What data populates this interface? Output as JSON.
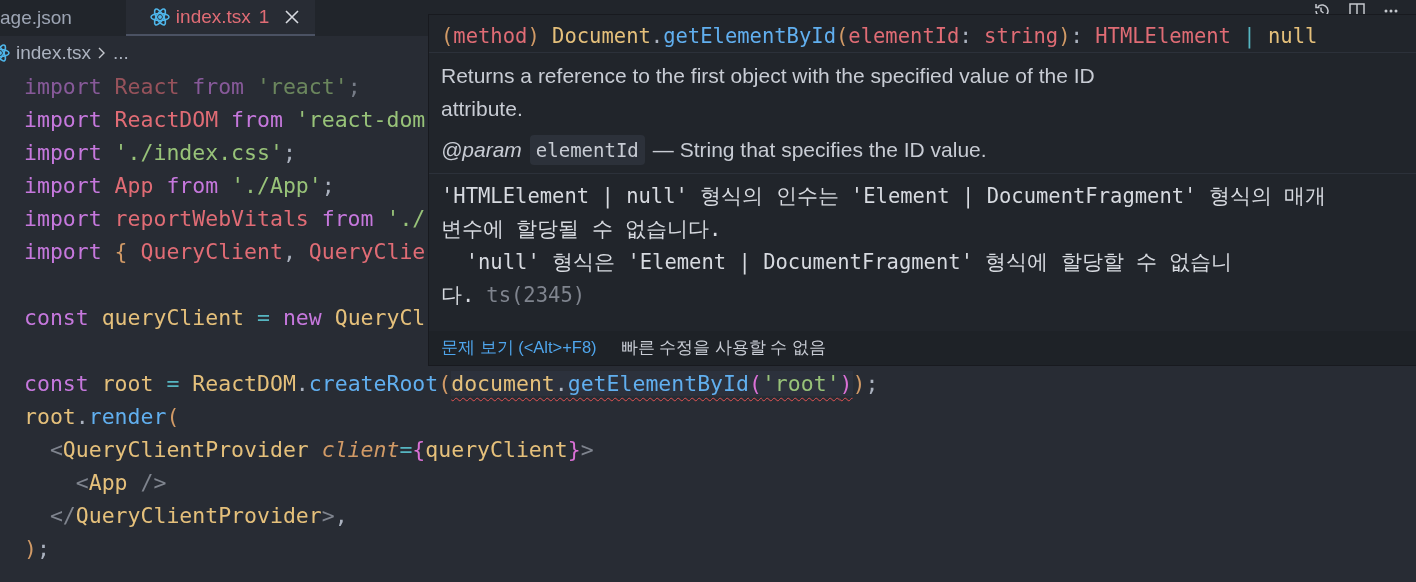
{
  "tabs": [
    {
      "label": "age.json",
      "selected": false
    },
    {
      "label": "index.tsx",
      "badge": "1",
      "selected": true
    }
  ],
  "breadcrumb": {
    "file": "index.tsx",
    "more": "..."
  },
  "code_lines": [
    {
      "kind": "code",
      "faded": true,
      "tokens": [
        {
          "kind": "keyword",
          "text": "import "
        },
        {
          "kind": "variable",
          "text": "React "
        },
        {
          "kind": "keyword",
          "text": "from "
        },
        {
          "kind": "string",
          "text": "'react'"
        },
        {
          "kind": "plain",
          "text": ";"
        }
      ]
    },
    {
      "kind": "code",
      "faded": false,
      "tokens": [
        {
          "kind": "keyword",
          "text": "import "
        },
        {
          "kind": "variable",
          "text": "ReactDOM "
        },
        {
          "kind": "keyword",
          "text": "from "
        },
        {
          "kind": "string",
          "text": "'react-dom"
        }
      ]
    },
    {
      "kind": "code",
      "faded": false,
      "tokens": [
        {
          "kind": "keyword",
          "text": "import "
        },
        {
          "kind": "string",
          "text": "'./index.css'"
        },
        {
          "kind": "plain",
          "text": ";"
        }
      ]
    },
    {
      "kind": "code",
      "faded": false,
      "tokens": [
        {
          "kind": "keyword",
          "text": "import "
        },
        {
          "kind": "variable",
          "text": "App "
        },
        {
          "kind": "keyword",
          "text": "from "
        },
        {
          "kind": "string",
          "text": "'./App'"
        },
        {
          "kind": "plain",
          "text": ";"
        }
      ]
    },
    {
      "kind": "code",
      "faded": false,
      "tokens": [
        {
          "kind": "keyword",
          "text": "import "
        },
        {
          "kind": "variable",
          "text": "reportWebVitals "
        },
        {
          "kind": "keyword",
          "text": "from "
        },
        {
          "kind": "string",
          "text": "'./"
        }
      ]
    },
    {
      "kind": "code",
      "faded": false,
      "tokens": [
        {
          "kind": "keyword",
          "text": "import "
        },
        {
          "kind": "bracket1",
          "text": "{ "
        },
        {
          "kind": "variable",
          "text": "QueryClient"
        },
        {
          "kind": "plain",
          "text": ", "
        },
        {
          "kind": "variable",
          "text": "QueryClie"
        }
      ]
    },
    {
      "kind": "blank"
    },
    {
      "kind": "code",
      "faded": false,
      "tokens": [
        {
          "kind": "keyword",
          "text": "const "
        },
        {
          "kind": "type",
          "text": "queryClient "
        },
        {
          "kind": "operator",
          "text": "= "
        },
        {
          "kind": "keyword",
          "text": "new "
        },
        {
          "kind": "type",
          "text": "QueryCl"
        }
      ]
    },
    {
      "kind": "blank"
    },
    {
      "kind": "code",
      "faded": false,
      "tokens": [
        {
          "kind": "keyword",
          "text": "const "
        },
        {
          "kind": "type",
          "text": "root "
        },
        {
          "kind": "operator",
          "text": "= "
        },
        {
          "kind": "type",
          "text": "ReactDOM"
        },
        {
          "kind": "plain",
          "text": "."
        },
        {
          "kind": "function",
          "text": "createRoot"
        },
        {
          "kind": "bracket1",
          "text": "("
        },
        {
          "kind": "error",
          "tokens": [
            {
              "kind": "type",
              "text": "document"
            },
            {
              "kind": "plain",
              "text": "."
            },
            {
              "kind": "function",
              "text": "getElementById"
            },
            {
              "kind": "bracket2",
              "text": "("
            },
            {
              "kind": "string",
              "text": "'root'"
            },
            {
              "kind": "bracket2",
              "text": ")"
            }
          ]
        },
        {
          "kind": "bracket1",
          "text": ")"
        },
        {
          "kind": "plain",
          "text": ";"
        }
      ]
    },
    {
      "kind": "code",
      "faded": false,
      "tokens": [
        {
          "kind": "type",
          "text": "root"
        },
        {
          "kind": "plain",
          "text": "."
        },
        {
          "kind": "function",
          "text": "render"
        },
        {
          "kind": "bracket1",
          "text": "("
        }
      ]
    },
    {
      "kind": "code",
      "faded": false,
      "tokens": [
        {
          "kind": "tag",
          "text": "  <"
        },
        {
          "kind": "type",
          "text": "QueryClientProvider "
        },
        {
          "kind": "attribute",
          "text": "client"
        },
        {
          "kind": "operator",
          "text": "="
        },
        {
          "kind": "bracket2",
          "text": "{"
        },
        {
          "kind": "type",
          "text": "queryClient"
        },
        {
          "kind": "bracket2",
          "text": "}"
        },
        {
          "kind": "tag",
          "text": ">"
        }
      ]
    },
    {
      "kind": "code",
      "faded": false,
      "tokens": [
        {
          "kind": "tag",
          "text": "    <"
        },
        {
          "kind": "type",
          "text": "App "
        },
        {
          "kind": "tag",
          "text": "/>"
        }
      ]
    },
    {
      "kind": "code",
      "faded": false,
      "tokens": [
        {
          "kind": "tag",
          "text": "  </"
        },
        {
          "kind": "type",
          "text": "QueryClientProvider"
        },
        {
          "kind": "tag",
          "text": ">"
        },
        {
          "kind": "plain",
          "text": ","
        }
      ]
    },
    {
      "kind": "code",
      "faded": false,
      "tokens": [
        {
          "kind": "bracket1",
          "text": ")"
        },
        {
          "kind": "plain",
          "text": ";"
        }
      ]
    }
  ],
  "hover": {
    "signature": [
      {
        "kind": "bracket1",
        "text": "("
      },
      {
        "kind": "variable",
        "text": "method"
      },
      {
        "kind": "bracket1",
        "text": ") "
      },
      {
        "kind": "type",
        "text": "Document"
      },
      {
        "kind": "plain",
        "text": "."
      },
      {
        "kind": "function",
        "text": "getElementById"
      },
      {
        "kind": "bracket1",
        "text": "("
      },
      {
        "kind": "variable",
        "text": "elementId"
      },
      {
        "kind": "plain",
        "text": ": "
      },
      {
        "kind": "variable",
        "text": "string"
      },
      {
        "kind": "bracket1",
        "text": ")"
      },
      {
        "kind": "plain",
        "text": ": "
      },
      {
        "kind": "variable",
        "text": "HTMLElement "
      },
      {
        "kind": "operator",
        "text": "| "
      },
      {
        "kind": "type",
        "text": "null"
      }
    ],
    "description": "Returns a reference to the first object with the specified value of the ID attribute.",
    "param": {
      "tag": "@param",
      "name": "elementId",
      "text": "— String that specifies the ID value."
    },
    "error_message": "'HTMLElement | null' 형식의 인수는 'Element | DocumentFragment' 형식의 매개 변수에 할당될 수 없습니다.",
    "error_detail": "'null' 형식은 'Element | DocumentFragment' 형식에 할당할 수 없습니다.",
    "error_code": "ts(2345)",
    "view_problem": "문제 보기 (<Alt>+F8)",
    "no_quick_fix": "빠른 수정을 사용할 수 없음"
  }
}
